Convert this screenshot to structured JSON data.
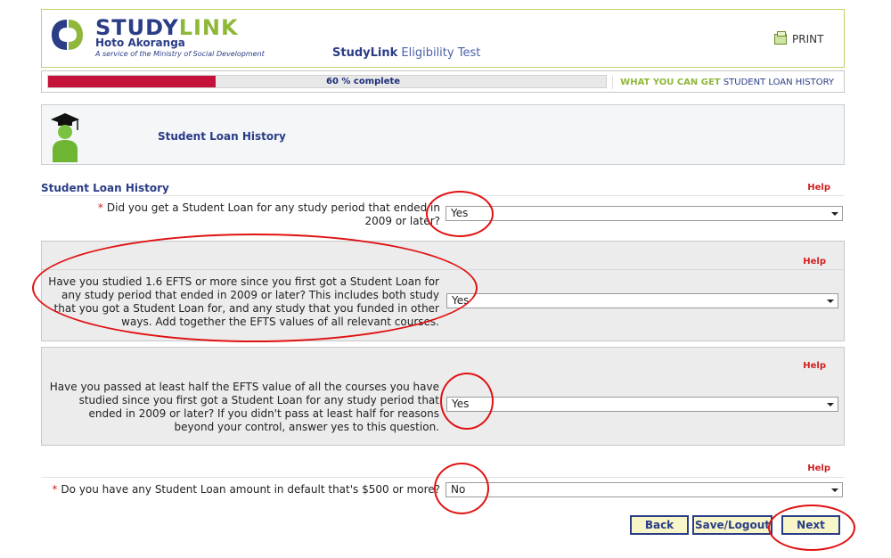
{
  "header": {
    "brand_part1": "STUDY",
    "brand_part2": "LINK",
    "brand_sub": "Hoto Akoranga",
    "brand_tagline": "A service of the Ministry of Social Development",
    "app_title_bold": "StudyLink",
    "app_title_rest": "Eligibility Test",
    "print_label": "PRINT",
    "print_icon": "printer-icon"
  },
  "progress": {
    "label": "60 % complete",
    "percent": 60,
    "color": "#c4123a"
  },
  "breadcrumb": {
    "step1": "WHAT YOU CAN GET",
    "step2": "STUDENT LOAN HISTORY"
  },
  "banner": {
    "title": "Student Loan History",
    "icon": "graduate-icon"
  },
  "section": {
    "title": "Student Loan History",
    "help": "Help"
  },
  "questions": [
    {
      "required_mark": "*",
      "label": "Did you get a Student Loan for any study period that ended in 2009 or later?",
      "value": "Yes",
      "help": ""
    },
    {
      "required_mark": "",
      "label": "Have you studied 1.6 EFTS or more since you first got a Student Loan for any study period that ended in 2009 or later? This includes both study that you got a Student Loan for, and any study that you funded in other ways. Add together the EFTS values of all relevant courses.",
      "value": "Yes",
      "help": "Help"
    },
    {
      "required_mark": "",
      "label": "Have you passed at least half the EFTS value of all the courses you have studied since you first got a Student Loan for any study period that ended in 2009 or later? If you didn't pass at least half for reasons beyond your control, answer yes to this question.",
      "value": "Yes",
      "help": "Help"
    },
    {
      "required_mark": "*",
      "label": "Do you have any Student Loan amount in default that's $500 or more?",
      "value": "No",
      "help": "Help"
    }
  ],
  "buttons": {
    "back": "Back",
    "save": "Save/Logout",
    "next": "Next"
  },
  "colors": {
    "brand_blue": "#2a3d86",
    "brand_green": "#8fb83a",
    "help_red": "#d21f1f",
    "annotation_red": "#e01111"
  }
}
